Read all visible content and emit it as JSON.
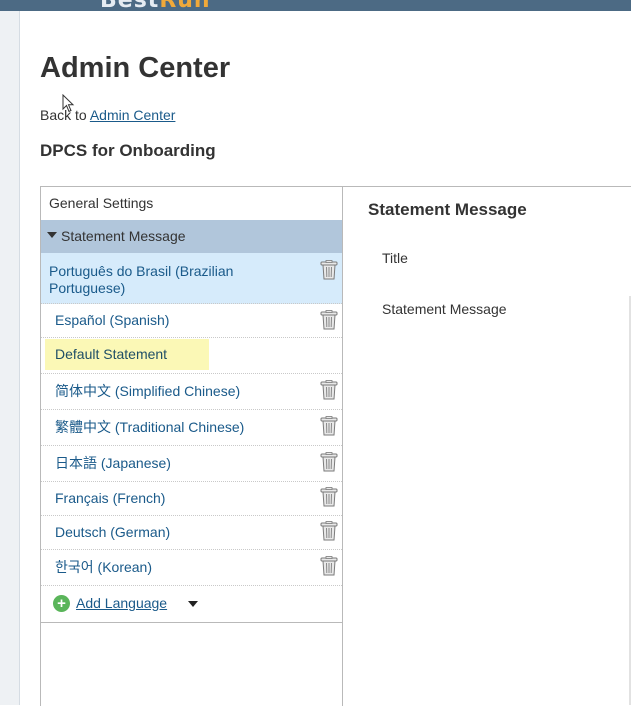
{
  "header": {
    "logo_text_part": "Best",
    "logo_text_accent": "Run"
  },
  "page": {
    "title": "Admin Center",
    "back_prefix": "Back to",
    "back_link": "Admin Center",
    "section_title": "DPCS for Onboarding"
  },
  "left_panel": {
    "general_settings": "General Settings",
    "section_header": "Statement Message",
    "languages": [
      {
        "label": "Português do Brasil (Brazilian Portuguese)",
        "selected": true
      },
      {
        "label": "Español (Spanish)"
      },
      {
        "label": "简体中文 (Simplified Chinese)"
      },
      {
        "label": "繁體中文 (Traditional Chinese)"
      },
      {
        "label": "日本語 (Japanese)"
      },
      {
        "label": "Français (French)"
      },
      {
        "label": "Deutsch (German)"
      },
      {
        "label": "한국어 (Korean)"
      }
    ],
    "default_statement": "Default Statement",
    "add_language": "Add Language"
  },
  "right_panel": {
    "title": "Statement Message",
    "field_title": "Title",
    "field_message": "Statement Message"
  },
  "icons": {
    "trash": "trash-icon",
    "add": "plus-circle-icon",
    "expand": "triangle-down-icon",
    "dropdown": "caret-down-icon"
  },
  "colors": {
    "header_bar": "#4c6a84",
    "section_header_bg": "#b1c6db",
    "selected_row_bg": "#d6ebfb",
    "default_highlight": "#fbf8b6",
    "link": "#1a5a8a",
    "add_icon": "#5ab55a"
  }
}
